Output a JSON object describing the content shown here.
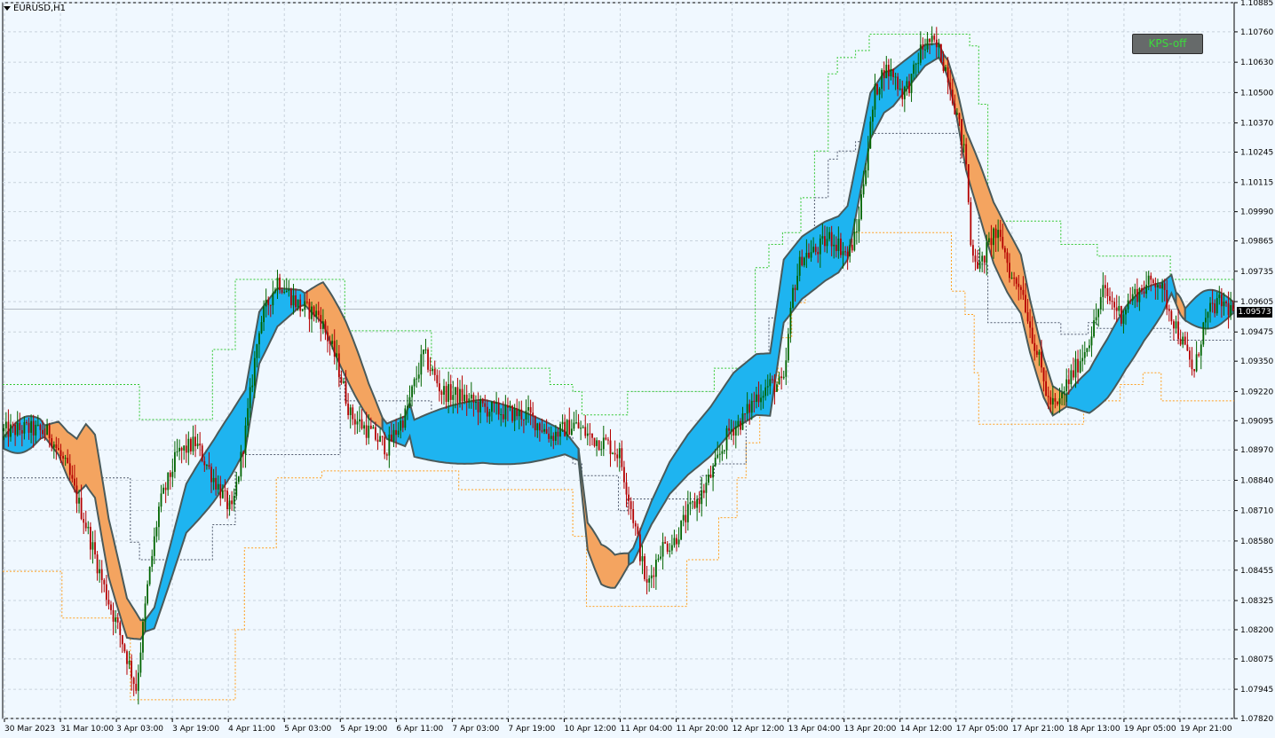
{
  "symbol": "EURUSD,H1",
  "kps_label": "KPS-off",
  "current_price": "1.09573",
  "colors": {
    "background": "#f0f8ff",
    "grid": "#c8d2dc",
    "bull_candle": "#006400",
    "bear_candle": "#b40000",
    "band_up_fill": "#1eb4f0",
    "band_down_fill": "#f4a460",
    "band_edge": "#4a5a5a",
    "upper_channel": "#32c832",
    "lower_channel": "#ffa020",
    "mid_channel": "#505a6e"
  },
  "chart_data": {
    "type": "candlestick",
    "title": "EURUSD,H1",
    "ylim": [
      1.0782,
      1.10885
    ],
    "y_ticks": [
      "1.10885",
      "1.10760",
      "1.10630",
      "1.10500",
      "1.10370",
      "1.10245",
      "1.10115",
      "1.09990",
      "1.09865",
      "1.09735",
      "1.09605",
      "1.09475",
      "1.09350",
      "1.09220",
      "1.09095",
      "1.08970",
      "1.08840",
      "1.08710",
      "1.08580",
      "1.08455",
      "1.08325",
      "1.08200",
      "1.08075",
      "1.07945",
      "1.07820"
    ],
    "x_labels": [
      "30 Mar 2023",
      "31 Mar 10:00",
      "3 Apr 03:00",
      "3 Apr 19:00",
      "4 Apr 11:00",
      "5 Apr 03:00",
      "5 Apr 19:00",
      "6 Apr 11:00",
      "7 Apr 03:00",
      "7 Apr 19:00",
      "10 Apr 12:00",
      "11 Apr 04:00",
      "11 Apr 20:00",
      "12 Apr 12:00",
      "13 Apr 04:00",
      "13 Apr 20:00",
      "14 Apr 12:00",
      "17 Apr 05:00",
      "17 Apr 21:00",
      "18 Apr 13:00",
      "19 Apr 05:00",
      "19 Apr 21:00"
    ],
    "price_anchors": [
      [
        0,
        1.0905
      ],
      [
        10,
        1.0906
      ],
      [
        20,
        1.0904
      ],
      [
        28,
        1.0888
      ],
      [
        36,
        1.0865
      ],
      [
        44,
        1.0838
      ],
      [
        52,
        1.0815
      ],
      [
        58,
        1.0795
      ],
      [
        63,
        1.0838
      ],
      [
        68,
        1.0872
      ],
      [
        76,
        1.0895
      ],
      [
        84,
        1.09
      ],
      [
        92,
        1.0885
      ],
      [
        100,
        1.087
      ],
      [
        106,
        1.0905
      ],
      [
        112,
        1.095
      ],
      [
        120,
        1.097
      ],
      [
        130,
        1.0958
      ],
      [
        138,
        1.0955
      ],
      [
        146,
        1.0935
      ],
      [
        152,
        1.0912
      ],
      [
        160,
        1.0905
      ],
      [
        168,
        1.0898
      ],
      [
        176,
        1.0912
      ],
      [
        184,
        1.0938
      ],
      [
        192,
        1.0922
      ],
      [
        200,
        1.092
      ],
      [
        210,
        1.0915
      ],
      [
        220,
        1.0913
      ],
      [
        230,
        1.0912
      ],
      [
        240,
        1.0903
      ],
      [
        250,
        1.0908
      ],
      [
        258,
        1.0902
      ],
      [
        264,
        1.09
      ],
      [
        270,
        1.0895
      ],
      [
        276,
        1.0868
      ],
      [
        282,
        1.0838
      ],
      [
        288,
        1.0855
      ],
      [
        294,
        1.0858
      ],
      [
        300,
        1.087
      ],
      [
        306,
        1.0878
      ],
      [
        312,
        1.089
      ],
      [
        318,
        1.0905
      ],
      [
        324,
        1.091
      ],
      [
        330,
        1.092
      ],
      [
        336,
        1.0925
      ],
      [
        342,
        1.0925
      ],
      [
        346,
        1.0965
      ],
      [
        350,
        1.098
      ],
      [
        356,
        1.0982
      ],
      [
        362,
        1.0988
      ],
      [
        366,
        1.0985
      ],
      [
        370,
        1.098
      ],
      [
        374,
        1.099
      ],
      [
        378,
        1.102
      ],
      [
        382,
        1.105
      ],
      [
        386,
        1.106
      ],
      [
        390,
        1.1058
      ],
      [
        394,
        1.105
      ],
      [
        398,
        1.1055
      ],
      [
        402,
        1.1068
      ],
      [
        406,
        1.1072
      ],
      [
        410,
        1.1068
      ],
      [
        414,
        1.1058
      ],
      [
        418,
        1.104
      ],
      [
        422,
        1.102
      ],
      [
        424,
        1.0985
      ],
      [
        428,
        1.0975
      ],
      [
        434,
        1.099
      ],
      [
        438,
        1.0985
      ],
      [
        442,
        1.097
      ],
      [
        446,
        1.0968
      ],
      [
        450,
        1.095
      ],
      [
        454,
        1.0935
      ],
      [
        458,
        1.0918
      ],
      [
        462,
        1.0915
      ],
      [
        466,
        1.0925
      ],
      [
        470,
        1.0932
      ],
      [
        474,
        1.094
      ],
      [
        478,
        1.095
      ],
      [
        482,
        1.0965
      ],
      [
        486,
        1.096
      ],
      [
        490,
        1.0955
      ],
      [
        494,
        1.0962
      ],
      [
        498,
        1.0965
      ],
      [
        502,
        1.0968
      ],
      [
        506,
        1.097
      ],
      [
        510,
        1.096
      ],
      [
        514,
        1.095
      ],
      [
        518,
        1.094
      ],
      [
        522,
        1.093
      ],
      [
        526,
        1.095
      ],
      [
        530,
        1.0958
      ],
      [
        534,
        1.096
      ],
      [
        538,
        1.0957
      ]
    ],
    "band_anchors": [
      [
        0,
        1.09
      ],
      [
        10,
        1.0904
      ],
      [
        16,
        1.0906
      ],
      [
        24,
        1.0902
      ],
      [
        28,
        1.0895
      ],
      [
        32,
        1.089
      ],
      [
        36,
        1.0895
      ],
      [
        40,
        1.089
      ],
      [
        46,
        1.0855
      ],
      [
        54,
        1.0825
      ],
      [
        60,
        1.082
      ],
      [
        66,
        1.0825
      ],
      [
        72,
        1.0845
      ],
      [
        80,
        1.0872
      ],
      [
        92,
        1.0888
      ],
      [
        100,
        1.09
      ],
      [
        106,
        1.091
      ],
      [
        112,
        1.0945
      ],
      [
        120,
        1.0958
      ],
      [
        130,
        1.0962
      ],
      [
        140,
        1.096
      ],
      [
        150,
        1.094
      ],
      [
        160,
        1.0918
      ],
      [
        168,
        1.0905
      ],
      [
        176,
        1.0905
      ],
      [
        178,
        1.091
      ],
      [
        180,
        1.0902
      ],
      [
        210,
        1.0905
      ],
      [
        230,
        1.0902
      ],
      [
        246,
        1.09
      ],
      [
        252,
        1.0895
      ],
      [
        256,
        1.086
      ],
      [
        262,
        1.0848
      ],
      [
        268,
        1.0845
      ],
      [
        276,
        1.0852
      ],
      [
        284,
        1.087
      ],
      [
        292,
        1.0885
      ],
      [
        300,
        1.0895
      ],
      [
        310,
        1.0905
      ],
      [
        320,
        1.0918
      ],
      [
        330,
        1.0925
      ],
      [
        336,
        1.0925
      ],
      [
        342,
        1.0965
      ],
      [
        350,
        1.0975
      ],
      [
        360,
        1.0982
      ],
      [
        366,
        1.0985
      ],
      [
        370,
        1.099
      ],
      [
        374,
        1.101
      ],
      [
        380,
        1.104
      ],
      [
        386,
        1.105
      ],
      [
        390,
        1.1052
      ],
      [
        396,
        1.1058
      ],
      [
        404,
        1.1066
      ],
      [
        410,
        1.1068
      ],
      [
        414,
        1.106
      ],
      [
        418,
        1.1045
      ],
      [
        422,
        1.1025
      ],
      [
        428,
        1.1008
      ],
      [
        434,
        1.099
      ],
      [
        440,
        1.0978
      ],
      [
        446,
        1.0968
      ],
      [
        450,
        1.095
      ],
      [
        456,
        1.0928
      ],
      [
        460,
        1.0918
      ],
      [
        466,
        1.0918
      ],
      [
        470,
        1.092
      ],
      [
        476,
        1.0922
      ],
      [
        484,
        1.0932
      ],
      [
        492,
        1.0945
      ],
      [
        500,
        1.0955
      ],
      [
        508,
        1.0962
      ],
      [
        512,
        1.0968
      ],
      [
        514,
        1.0962
      ],
      [
        518,
        1.0955
      ],
      [
        526,
        1.0957
      ],
      [
        538,
        1.0958
      ]
    ],
    "band_direction": [
      [
        0,
        "up"
      ],
      [
        18,
        "down"
      ],
      [
        62,
        "up"
      ],
      [
        132,
        "down"
      ],
      [
        166,
        "up"
      ],
      [
        252,
        "down"
      ],
      [
        274,
        "up"
      ],
      [
        412,
        "down"
      ],
      [
        466,
        "up"
      ],
      [
        514,
        "down"
      ],
      [
        518,
        "up"
      ]
    ],
    "upper_channel": [
      [
        0,
        1.0925
      ],
      [
        56,
        1.0925
      ],
      [
        60,
        1.091
      ],
      [
        70,
        1.091
      ],
      [
        92,
        1.094
      ],
      [
        100,
        1.094
      ],
      [
        102,
        1.097
      ],
      [
        148,
        1.097
      ],
      [
        150,
        1.0948
      ],
      [
        186,
        1.0948
      ],
      [
        188,
        1.0932
      ],
      [
        230,
        1.0932
      ],
      [
        240,
        1.0925
      ],
      [
        250,
        1.0922
      ],
      [
        254,
        1.0912
      ],
      [
        270,
        1.0912
      ],
      [
        274,
        1.0922
      ],
      [
        306,
        1.0922
      ],
      [
        312,
        1.0932
      ],
      [
        326,
        1.0932
      ],
      [
        330,
        1.0975
      ],
      [
        336,
        1.0985
      ],
      [
        342,
        1.099
      ],
      [
        350,
        1.1005
      ],
      [
        356,
        1.1025
      ],
      [
        362,
        1.1058
      ],
      [
        366,
        1.1065
      ],
      [
        374,
        1.1068
      ],
      [
        380,
        1.1075
      ],
      [
        420,
        1.1075
      ],
      [
        424,
        1.107
      ],
      [
        428,
        1.1045
      ],
      [
        432,
        1.0995
      ],
      [
        460,
        1.0995
      ],
      [
        464,
        1.0985
      ],
      [
        476,
        1.0985
      ],
      [
        480,
        1.098
      ],
      [
        510,
        1.098
      ],
      [
        512,
        1.097
      ],
      [
        538,
        1.097
      ]
    ],
    "lower_channel": [
      [
        0,
        1.0845
      ],
      [
        24,
        1.0845
      ],
      [
        26,
        1.0825
      ],
      [
        40,
        1.0825
      ],
      [
        56,
        1.079
      ],
      [
        98,
        1.079
      ],
      [
        102,
        1.082
      ],
      [
        106,
        1.0855
      ],
      [
        120,
        1.0885
      ],
      [
        140,
        1.0888
      ],
      [
        160,
        1.0888
      ],
      [
        170,
        1.0888
      ],
      [
        200,
        1.088
      ],
      [
        240,
        1.088
      ],
      [
        250,
        1.086
      ],
      [
        256,
        1.083
      ],
      [
        290,
        1.083
      ],
      [
        300,
        1.085
      ],
      [
        314,
        1.0868
      ],
      [
        322,
        1.0885
      ],
      [
        326,
        1.09
      ],
      [
        332,
        1.0912
      ],
      [
        336,
        1.0922
      ],
      [
        340,
        1.0945
      ],
      [
        346,
        1.096
      ],
      [
        352,
        1.0985
      ],
      [
        370,
        1.099
      ],
      [
        374,
        1.099
      ],
      [
        384,
        1.099
      ],
      [
        400,
        1.099
      ],
      [
        410,
        1.099
      ],
      [
        416,
        1.0965
      ],
      [
        422,
        1.0955
      ],
      [
        426,
        1.093
      ],
      [
        428,
        1.0908
      ],
      [
        454,
        1.0908
      ],
      [
        470,
        1.0908
      ],
      [
        474,
        1.0918
      ],
      [
        486,
        1.0918
      ],
      [
        490,
        1.0925
      ],
      [
        500,
        1.093
      ],
      [
        506,
        1.093
      ],
      [
        508,
        1.0918
      ],
      [
        538,
        1.0918
      ]
    ]
  }
}
